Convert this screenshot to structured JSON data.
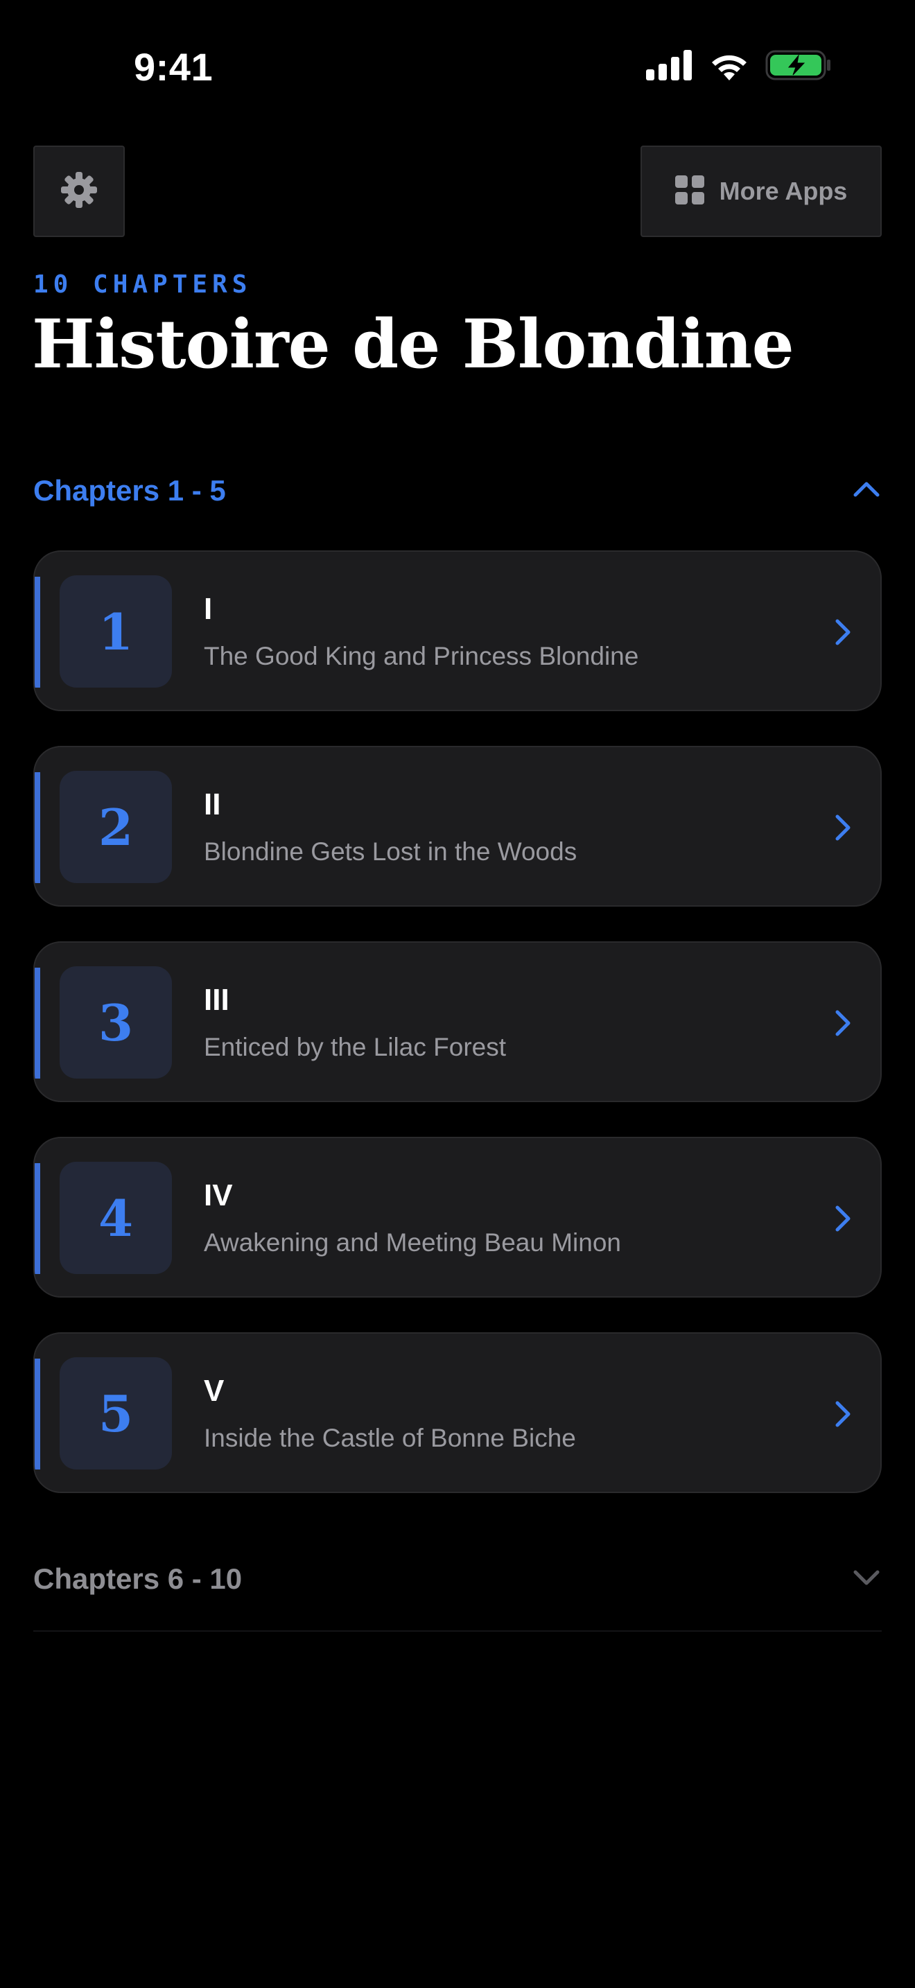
{
  "status_bar": {
    "time": "9:41",
    "icons": [
      "cellular-signal-icon",
      "wifi-icon",
      "battery-charging-icon"
    ],
    "battery_color": "#34c759"
  },
  "header": {
    "settings_icon": "gear-icon",
    "more_apps": {
      "icon": "grid-icon",
      "label": "More Apps"
    },
    "chapter_count": "10 CHAPTERS",
    "title": "Histoire de Blondine"
  },
  "colors": {
    "accent": "#3d7ef0",
    "background": "#000000",
    "card": "#1c1c1e"
  },
  "sections": [
    {
      "title": "Chapters 1 - 5",
      "expanded": true,
      "chevron_icon": "chevron-up-icon",
      "chapters": [
        {
          "number": "1",
          "roman": "I",
          "subtitle": "The Good King and Princess Blondine"
        },
        {
          "number": "2",
          "roman": "II",
          "subtitle": "Blondine Gets Lost in the Woods"
        },
        {
          "number": "3",
          "roman": "III",
          "subtitle": "Enticed by the Lilac Forest"
        },
        {
          "number": "4",
          "roman": "IV",
          "subtitle": "Awakening and Meeting Beau Minon"
        },
        {
          "number": "5",
          "roman": "V",
          "subtitle": "Inside the Castle of Bonne Biche"
        }
      ]
    },
    {
      "title": "Chapters 6 - 10",
      "expanded": false,
      "chevron_icon": "chevron-down-icon"
    }
  ]
}
